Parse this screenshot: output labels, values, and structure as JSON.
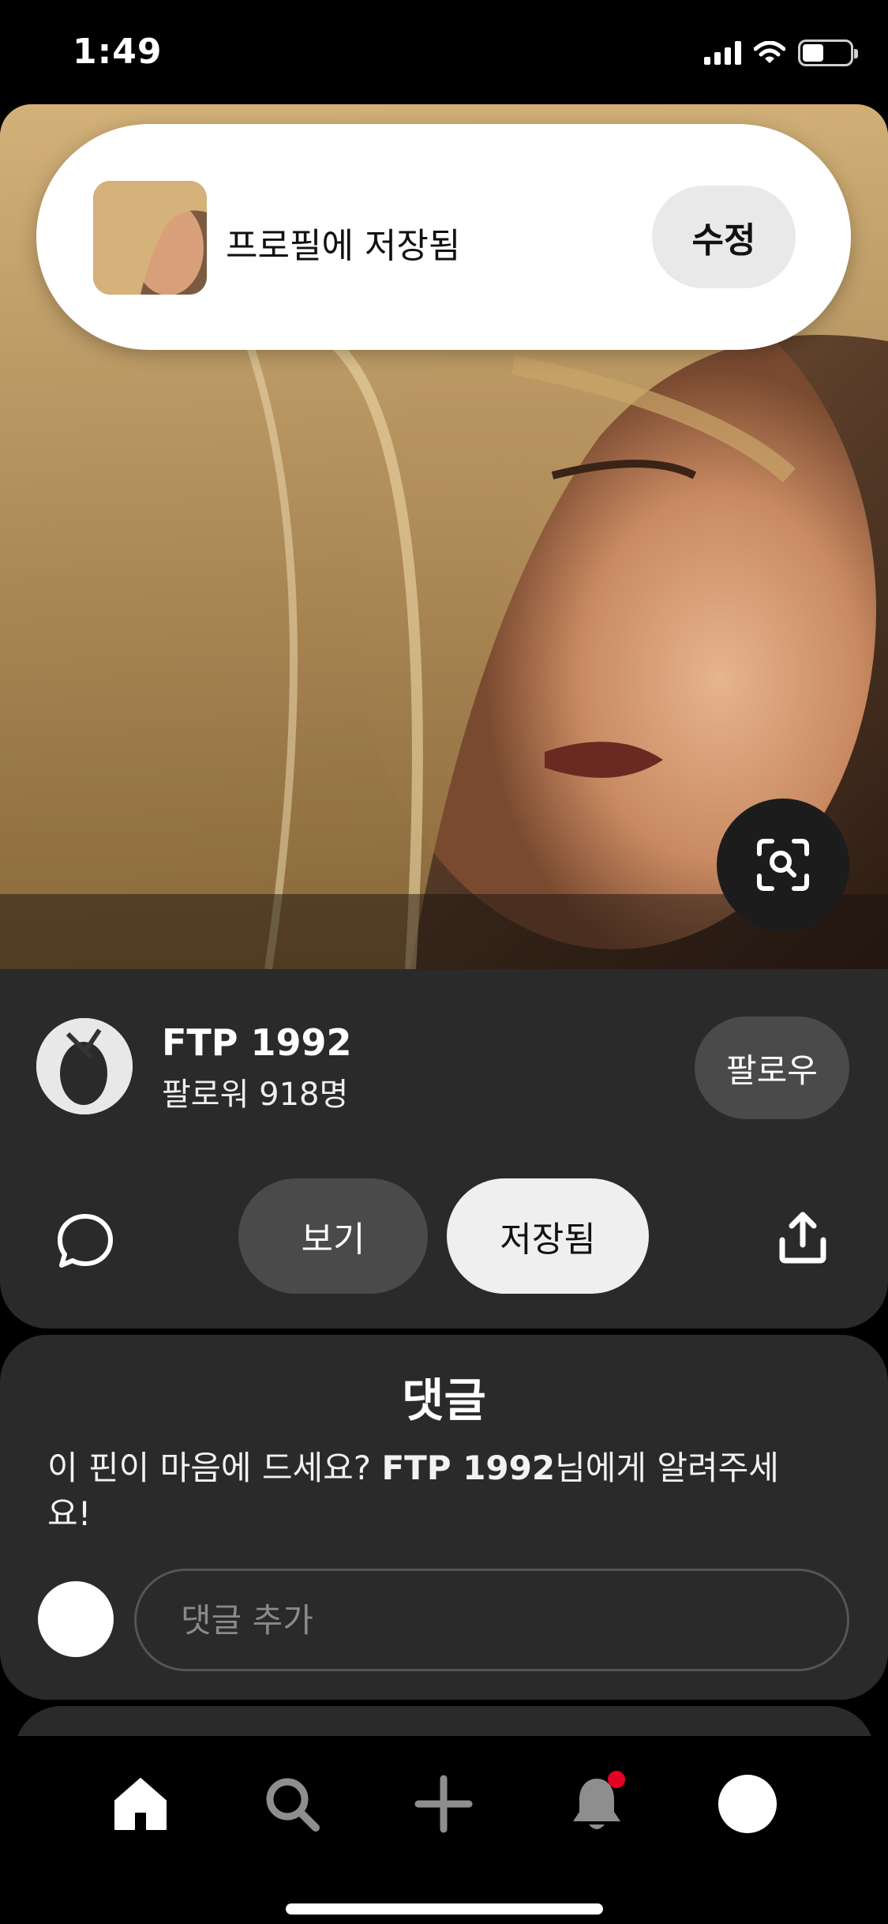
{
  "status_bar": {
    "time": "1:49"
  },
  "toast": {
    "message": "프로필에 저장됨",
    "edit_label": "수정"
  },
  "pin": {
    "creator_name": "FTP 1992",
    "followers": "팔로워 918명",
    "follow_label": "팔로우",
    "view_label": "보기",
    "saved_label": "저장됨"
  },
  "comments": {
    "title": "댓글",
    "prompt_before": "이 핀이 마음에 드세요? ",
    "prompt_name": "FTP 1992",
    "prompt_after": "님에게 알려주세요!",
    "input_placeholder": "댓글 추가"
  },
  "bottom_nav": {
    "items": [
      "home-icon",
      "search-icon",
      "plus-icon",
      "bell-icon",
      "profile-avatar"
    ],
    "active": "home-icon",
    "notification_color": "#e60023"
  },
  "colors": {
    "panel": "#2a2a2a",
    "accent": "#e60023"
  }
}
